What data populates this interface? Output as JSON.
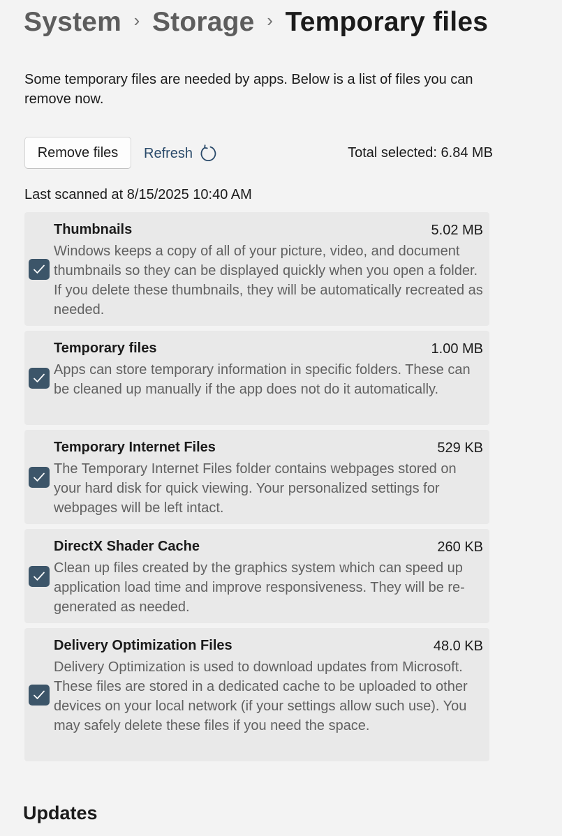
{
  "breadcrumb": {
    "items": [
      "System",
      "Storage"
    ],
    "current": "Temporary files",
    "separator": "›"
  },
  "intro": "Some temporary files are needed by apps. Below is a list of files you can remove now.",
  "actions": {
    "remove_label": "Remove files",
    "refresh_label": "Refresh",
    "refresh_icon": "refresh-icon",
    "total_selected": "Total selected: 6.84 MB"
  },
  "last_scanned": "Last scanned at 8/15/2025 10:40 AM",
  "categories": [
    {
      "title": "Thumbnails",
      "size": "5.02 MB",
      "checked": true,
      "description": "Windows keeps a copy of all of your picture, video, and document thumbnails so they can be displayed quickly when you open a folder. If you delete these thumbnails, they will be automatically recreated as needed."
    },
    {
      "title": "Temporary files",
      "size": "1.00 MB",
      "checked": true,
      "description": "Apps can store temporary information in specific folders. These can be cleaned up manually if the app does not do it automatically."
    },
    {
      "title": "Temporary Internet Files",
      "size": "529 KB",
      "checked": true,
      "description": "The Temporary Internet Files folder contains webpages stored on your hard disk for quick viewing. Your personalized settings for webpages will be left intact."
    },
    {
      "title": "DirectX Shader Cache",
      "size": "260 KB",
      "checked": true,
      "description": "Clean up files created by the graphics system which can speed up application load time and improve responsiveness. They will be re-generated as needed."
    },
    {
      "title": "Delivery Optimization Files",
      "size": "48.0 KB",
      "checked": true,
      "description": "Delivery Optimization is used to download updates from Microsoft. These files are stored in a dedicated cache to be uploaded to other devices on your local network (if your settings allow such use). You may safely delete these files if you need the space."
    }
  ],
  "next_section": "Updates",
  "colors": {
    "background": "#f3f3f3",
    "card": "#e9e9e9",
    "checkbox": "#3c5569",
    "link": "#2a4a6a",
    "secondary_text": "#616161"
  }
}
